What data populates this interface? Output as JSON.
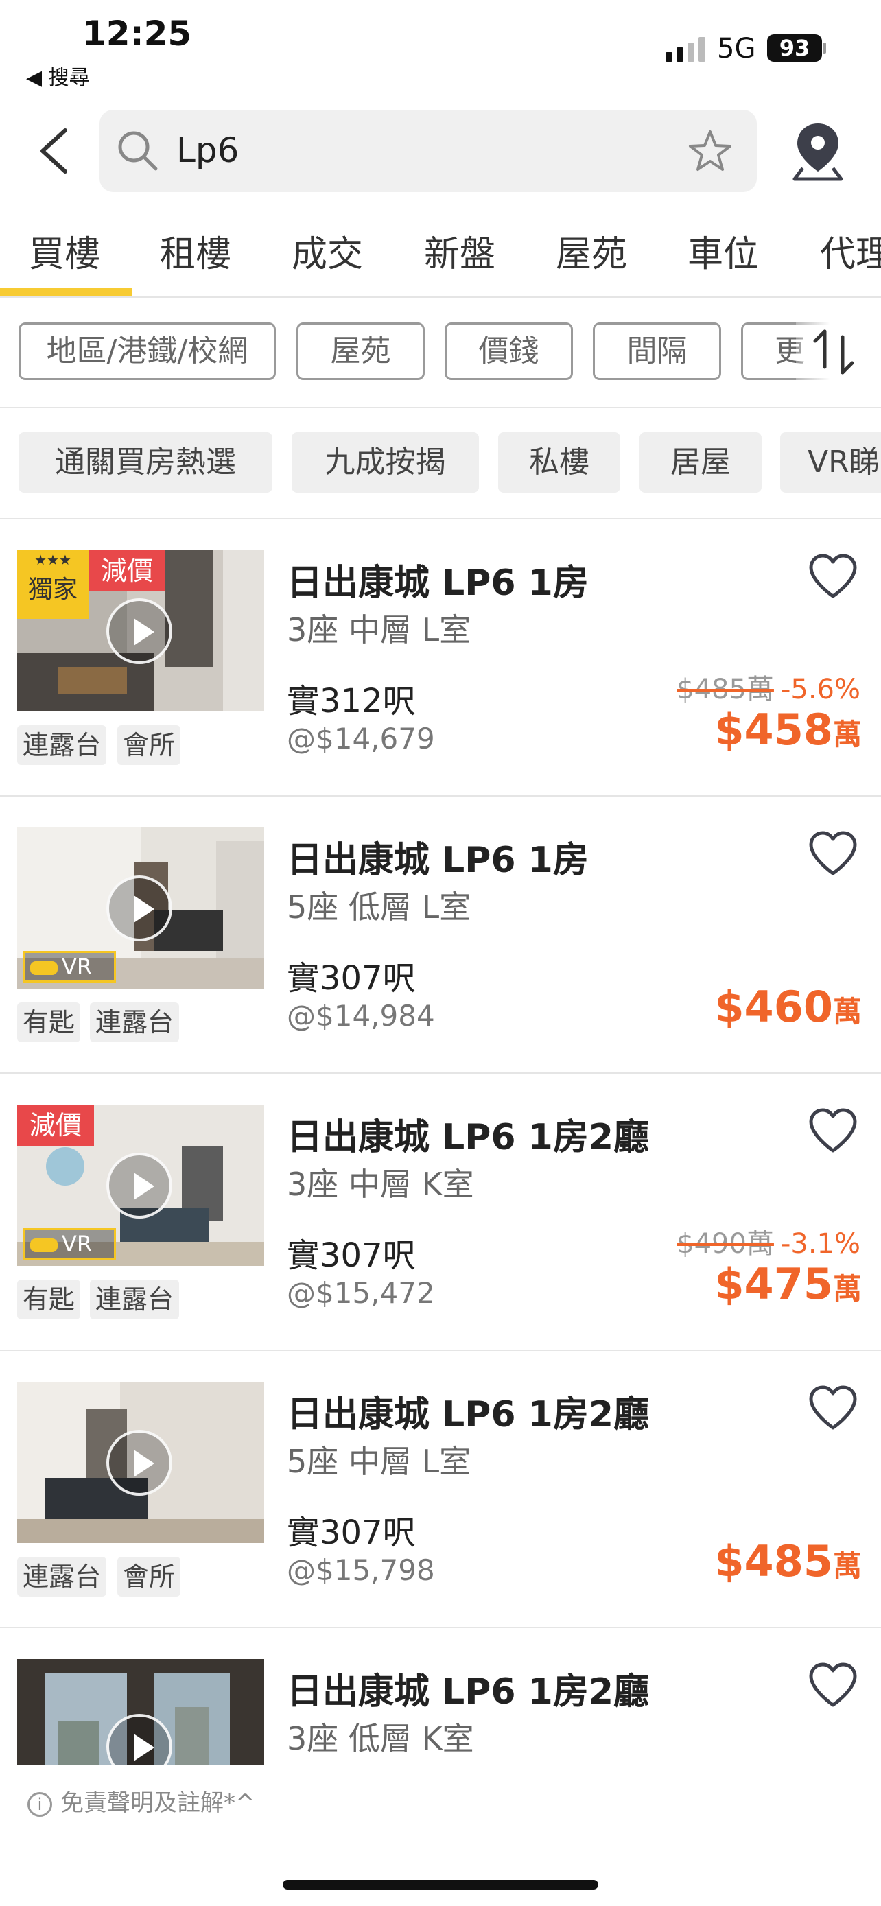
{
  "status_bar": {
    "time": "12:25",
    "back_app": "◀ 搜尋",
    "network": "5G",
    "battery": "93"
  },
  "search": {
    "query": "Lp6"
  },
  "tabs": [
    {
      "label": "買樓",
      "active": true
    },
    {
      "label": "租樓"
    },
    {
      "label": "成交"
    },
    {
      "label": "新盤"
    },
    {
      "label": "屋苑"
    },
    {
      "label": "車位"
    },
    {
      "label": "代理"
    }
  ],
  "filters": [
    "地區/港鐵/校網",
    "屋苑",
    "價錢",
    "間隔",
    "更"
  ],
  "chips": [
    "通關買房熱選",
    "九成按揭",
    "私樓",
    "居屋",
    "VR睇"
  ],
  "badges": {
    "exclusive": "獨家",
    "price_cut": "減價",
    "vr": "VR"
  },
  "listings": [
    {
      "title": "日出康城 LP6 1房",
      "sub": "3座 中層 L室",
      "area": "實312呎",
      "unit_price": "@$14,679",
      "orig_price": "$485萬",
      "change": "-5.6%",
      "price": "$458",
      "price_unit": "萬",
      "tags": [
        "連露台",
        "會所"
      ]
    },
    {
      "title": "日出康城 LP6 1房",
      "sub": "5座 低層 L室",
      "area": "實307呎",
      "unit_price": "@$14,984",
      "price": "$460",
      "price_unit": "萬",
      "tags": [
        "有匙",
        "連露台"
      ]
    },
    {
      "title": "日出康城 LP6 1房2廳",
      "sub": "3座 中層 K室",
      "area": "實307呎",
      "unit_price": "@$15,472",
      "orig_price": "$490萬",
      "change": "-3.1%",
      "price": "$475",
      "price_unit": "萬",
      "tags": [
        "有匙",
        "連露台"
      ]
    },
    {
      "title": "日出康城 LP6 1房2廳",
      "sub": "5座 中層 L室",
      "area": "實307呎",
      "unit_price": "@$15,798",
      "price": "$485",
      "price_unit": "萬",
      "tags": [
        "連露台",
        "會所"
      ]
    },
    {
      "title": "日出康城 LP6 1房2廳",
      "sub": "3座 低層 K室"
    }
  ],
  "disclaimer": "免責聲明及註解*^",
  "colors": {
    "accent": "#f0652a",
    "tab_indicator": "#f7cb33",
    "badge_red": "#e8484a",
    "badge_yellow": "#f5c623"
  }
}
